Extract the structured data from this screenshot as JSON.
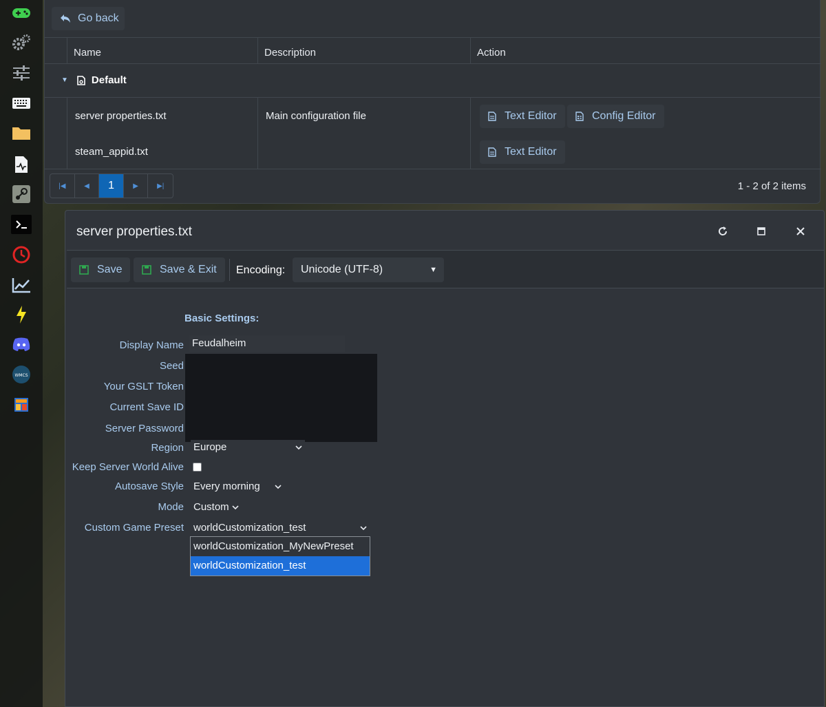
{
  "sidebar": {
    "icons": [
      "gamepad-icon",
      "gears-icon",
      "sliders-icon",
      "keyboard-icon",
      "folder-icon",
      "file-pulse-icon",
      "steam-icon",
      "terminal-icon",
      "clock-icon",
      "chart-icon",
      "lightning-icon",
      "discord-icon",
      "wmcs-icon",
      "layout-icon"
    ],
    "wmcs_label": "WMCS",
    "colors": {
      "gamepad": "#3fcf4f",
      "folder": "#f3c060",
      "clock": "#e02424",
      "lightning": "#f5e422",
      "discord": "#5865f2"
    }
  },
  "file_browser": {
    "go_back_label": "Go back",
    "columns": [
      "Name",
      "Description",
      "Action"
    ],
    "group": {
      "label": "Default"
    },
    "rows": [
      {
        "name": "server properties.txt",
        "description": "Main configuration file",
        "actions": [
          "Text Editor",
          "Config Editor"
        ]
      },
      {
        "name": "steam_appid.txt",
        "description": "",
        "actions": [
          "Text Editor"
        ]
      }
    ],
    "pager": {
      "current_page": "1"
    },
    "items_label": "1 - 2 of 2 items"
  },
  "editor": {
    "title": "server properties.txt",
    "toolbar": {
      "save_label": "Save",
      "save_exit_label": "Save & Exit",
      "encoding_label": "Encoding:",
      "encoding_value": "Unicode (UTF-8)"
    },
    "section_title": "Basic Settings:",
    "fields": {
      "display_name": {
        "label": "Display Name",
        "value": "Feudalheim"
      },
      "seed": {
        "label": "Seed"
      },
      "gslt_token": {
        "label": "Your GSLT Token"
      },
      "current_save_id": {
        "label": "Current Save ID"
      },
      "server_password": {
        "label": "Server Password"
      },
      "region": {
        "label": "Region",
        "value": "Europe"
      },
      "keep_alive": {
        "label": "Keep Server World Alive",
        "checked": false
      },
      "autosave_style": {
        "label": "Autosave Style",
        "value": "Every morning"
      },
      "mode": {
        "label": "Mode",
        "value": "Custom"
      },
      "custom_preset": {
        "label": "Custom Game Preset",
        "value": "worldCustomization_test",
        "options": [
          "worldCustomization_MyNewPreset",
          "worldCustomization_test"
        ]
      }
    }
  },
  "accent_color": "#a9cbee",
  "selected_option_color": "#1e6fd9"
}
